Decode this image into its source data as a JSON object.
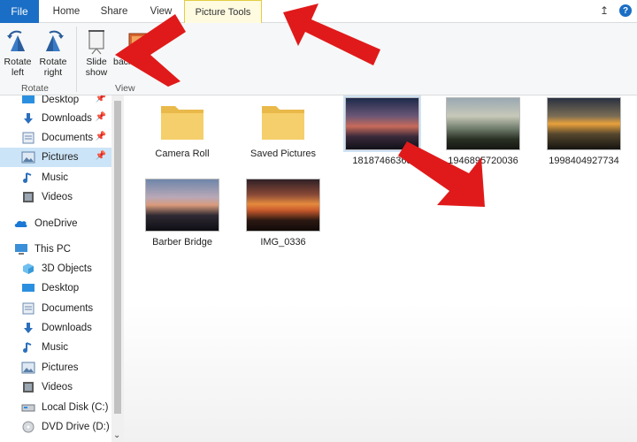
{
  "tabs": {
    "file": "File",
    "home": "Home",
    "share": "Share",
    "view": "View",
    "picture_tools": "Picture Tools",
    "help": "?"
  },
  "ribbon": {
    "rotate_left": "Rotate left",
    "rotate_right": "Rotate right",
    "slide_show": "Slide show",
    "set_background": "background",
    "group_rotate": "Rotate",
    "group_view": "View"
  },
  "nav": {
    "items": [
      {
        "label": "Desktop",
        "icon": "desktop-icon",
        "pinned": true
      },
      {
        "label": "Downloads",
        "icon": "downloads-icon",
        "pinned": true
      },
      {
        "label": "Documents",
        "icon": "documents-icon",
        "pinned": true
      },
      {
        "label": "Pictures",
        "icon": "pictures-icon",
        "pinned": true,
        "selected": true
      },
      {
        "label": "Music",
        "icon": "music-icon"
      },
      {
        "label": "Videos",
        "icon": "videos-icon"
      },
      {
        "label": "OneDrive",
        "icon": "onedrive-icon"
      },
      {
        "label": "This PC",
        "icon": "this-pc-icon"
      },
      {
        "label": "3D Objects",
        "icon": "3d-objects-icon"
      },
      {
        "label": "Desktop",
        "icon": "desktop-icon"
      },
      {
        "label": "Documents",
        "icon": "documents-icon"
      },
      {
        "label": "Downloads",
        "icon": "downloads-icon"
      },
      {
        "label": "Music",
        "icon": "music-icon"
      },
      {
        "label": "Pictures",
        "icon": "pictures-icon"
      },
      {
        "label": "Videos",
        "icon": "videos-icon"
      },
      {
        "label": "Local Disk (C:)",
        "icon": "local-disk-icon"
      },
      {
        "label": "DVD Drive (D:) Y",
        "icon": "dvd-drive-icon"
      }
    ]
  },
  "files": [
    {
      "name": "Camera Roll",
      "kind": "folder"
    },
    {
      "name": "Saved Pictures",
      "kind": "folder"
    },
    {
      "name": "18187466363",
      "kind": "image",
      "selected": true
    },
    {
      "name": "1946895720036",
      "kind": "image"
    },
    {
      "name": "1998404927734",
      "kind": "image"
    },
    {
      "name": "Barber Bridge",
      "kind": "image"
    },
    {
      "name": "IMG_0336",
      "kind": "image"
    }
  ],
  "colors": {
    "file_tab": "#1a6ec5",
    "picture_tools_tab": "#fffbe0",
    "selection": "#cce4f7",
    "annotation_arrow": "#e01a1a",
    "folder": "#f5cf6b"
  }
}
